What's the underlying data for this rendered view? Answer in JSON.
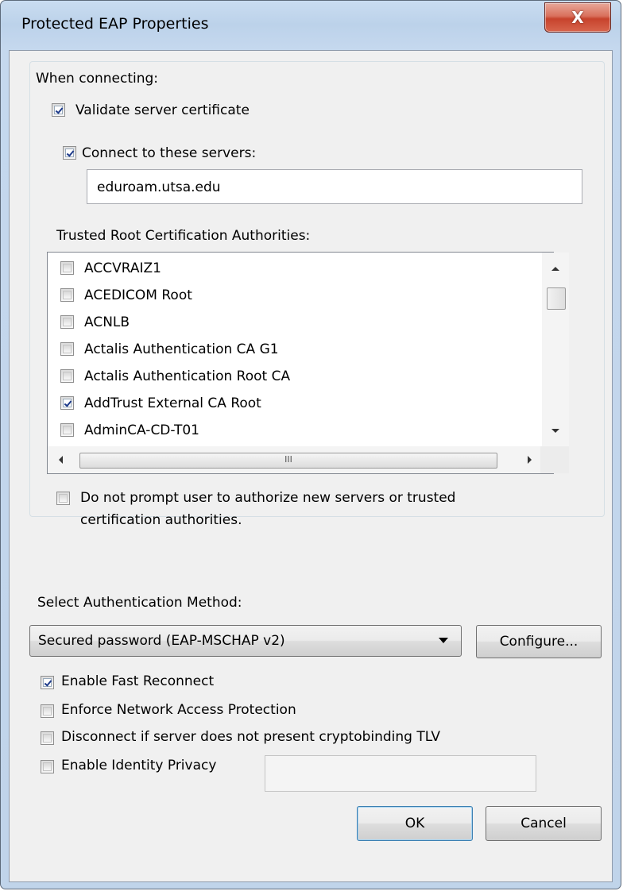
{
  "window": {
    "title": "Protected EAP Properties",
    "close_label": "X"
  },
  "connecting": {
    "heading": "When connecting:",
    "validate_cert": {
      "label": "Validate server certificate",
      "checked": true
    },
    "connect_servers": {
      "label": "Connect to these servers:",
      "checked": true
    },
    "servers_value": "eduroam.utsa.edu",
    "trusted_heading": "Trusted Root Certification Authorities:",
    "authorities": [
      {
        "label": "ACCVRAIZ1",
        "checked": false
      },
      {
        "label": "ACEDICOM Root",
        "checked": false
      },
      {
        "label": "ACNLB",
        "checked": false
      },
      {
        "label": "Actalis Authentication CA G1",
        "checked": false
      },
      {
        "label": "Actalis Authentication Root CA",
        "checked": false
      },
      {
        "label": "AddTrust External CA Root",
        "checked": true
      },
      {
        "label": "AdminCA-CD-T01",
        "checked": false
      }
    ],
    "hscroll_grip": "III",
    "no_prompt": {
      "line1": "Do not prompt user to authorize new servers or trusted",
      "line2": "certification authorities.",
      "checked": false
    }
  },
  "auth": {
    "heading": "Select Authentication Method:",
    "method": "Secured password (EAP-MSCHAP v2)",
    "configure_label": "Configure..."
  },
  "options": [
    {
      "label": "Enable Fast Reconnect",
      "checked": true
    },
    {
      "label": "Enforce Network Access Protection",
      "checked": false
    },
    {
      "label": "Disconnect if server does not present cryptobinding TLV",
      "checked": false
    },
    {
      "label": "Enable Identity Privacy",
      "checked": false
    }
  ],
  "identity_value": "",
  "buttons": {
    "ok": "OK",
    "cancel": "Cancel"
  }
}
